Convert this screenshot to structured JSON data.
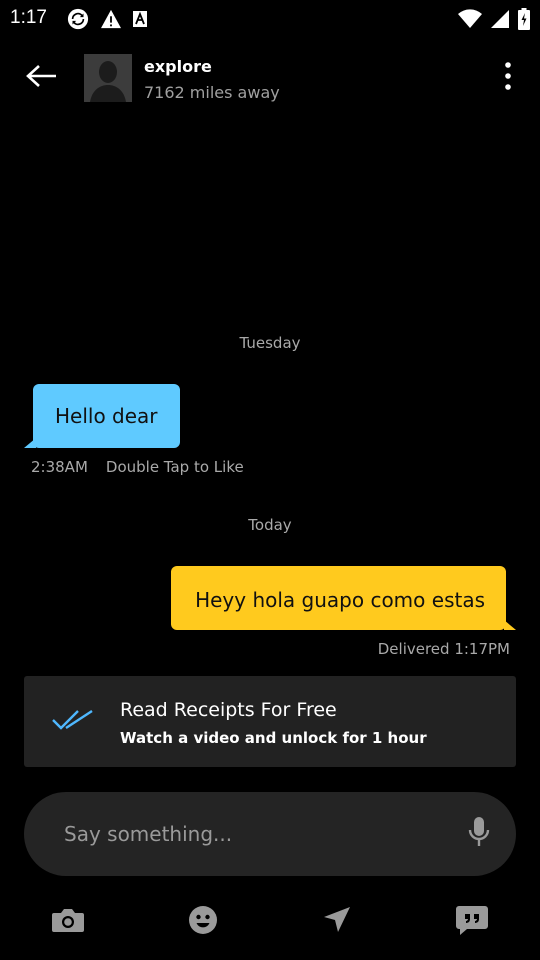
{
  "status_bar": {
    "time": "1:17",
    "icons": [
      "sync-icon",
      "warning-icon",
      "font-a-icon",
      "wifi-icon",
      "signal-icon",
      "battery-icon"
    ]
  },
  "header": {
    "contact_name": "explore",
    "distance": "7162 miles away",
    "icons": [
      "back-arrow-icon",
      "avatar-silhouette",
      "more-vert-icon"
    ]
  },
  "conversation": {
    "day_1": "Tuesday",
    "incoming_message": {
      "text": "Hello dear",
      "time": "2:38AM",
      "hint": "Double Tap to Like",
      "bubble_color": "#5fcaff"
    },
    "day_2": "Today",
    "outgoing_message": {
      "text": "Heyy hola guapo como estas",
      "status": "Delivered 1:17PM",
      "bubble_color": "#ffca1e"
    }
  },
  "promo": {
    "title": "Read Receipts For Free",
    "subtitle": "Watch a video and unlock for 1 hour",
    "icon": "double-check-icon",
    "accent": "#4fb8ff"
  },
  "composer": {
    "placeholder": "Say something...",
    "icon": "mic-icon"
  },
  "bottom_bar": {
    "icons": [
      "camera-icon",
      "emoji-icon",
      "location-send-icon",
      "saved-phrases-icon"
    ]
  }
}
